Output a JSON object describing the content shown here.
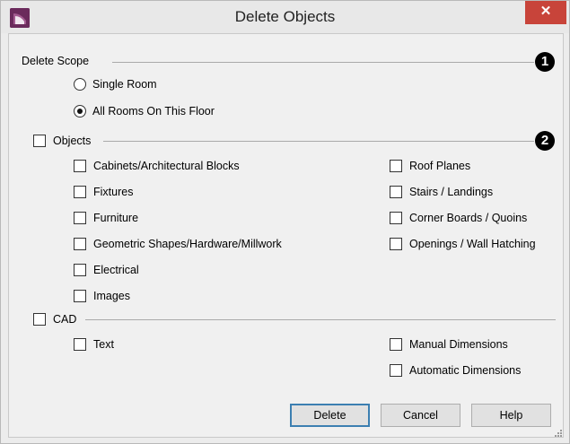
{
  "window": {
    "title": "Delete Objects",
    "close_label": "✕"
  },
  "scope": {
    "label": "Delete Scope",
    "marker": "1",
    "options": [
      {
        "label": "Single Room",
        "checked": false
      },
      {
        "label": "All Rooms On This Floor",
        "checked": true
      }
    ]
  },
  "objects": {
    "label": "Objects",
    "marker": "2",
    "checked": false,
    "left": [
      {
        "label": "Cabinets/Architectural Blocks",
        "checked": false
      },
      {
        "label": "Fixtures",
        "checked": false
      },
      {
        "label": "Furniture",
        "checked": false
      },
      {
        "label": "Geometric Shapes/Hardware/Millwork",
        "checked": false
      },
      {
        "label": "Electrical",
        "checked": false
      },
      {
        "label": "Images",
        "checked": false
      }
    ],
    "right": [
      {
        "label": "Roof Planes",
        "checked": false
      },
      {
        "label": "Stairs / Landings",
        "checked": false
      },
      {
        "label": "Corner Boards / Quoins",
        "checked": false
      },
      {
        "label": "Openings / Wall Hatching",
        "checked": false
      }
    ]
  },
  "cad": {
    "label": "CAD",
    "checked": false,
    "left": [
      {
        "label": "Text",
        "checked": false
      }
    ],
    "right": [
      {
        "label": "Manual Dimensions",
        "checked": false
      },
      {
        "label": "Automatic Dimensions",
        "checked": false
      }
    ]
  },
  "buttons": {
    "delete": "Delete",
    "cancel": "Cancel",
    "help": "Help"
  }
}
